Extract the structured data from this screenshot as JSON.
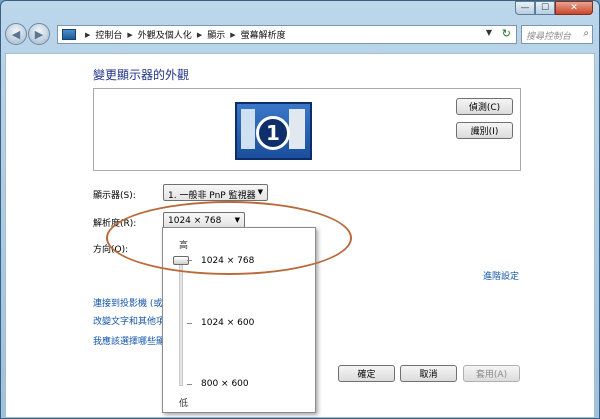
{
  "window": {
    "caption_buttons": [
      "—",
      "☐",
      "✕"
    ]
  },
  "address_bar": {
    "crumbs": [
      "控制台",
      "外觀及個人化",
      "顯示",
      "螢幕解析度"
    ],
    "search_placeholder": "搜尋控制台"
  },
  "main": {
    "title": "變更顯示器的外觀",
    "detect_button": "偵測(C)",
    "identify_button": "識別(I)",
    "monitor_number": "1",
    "display_label": "顯示器(S):",
    "display_value": "1. 一般非 PnP 監視器",
    "resolution_label": "解析度(R):",
    "resolution_value": "1024 × 768",
    "orientation_label": "方向(O):",
    "advanced_link": "進階設定",
    "links": [
      "連接到投影機 (或按",
      "改變文字和其他項",
      "我應該選擇哪些顯"
    ],
    "ok_button": "確定",
    "cancel_button": "取消",
    "apply_button": "套用(A)"
  },
  "resolution_popup": {
    "high_label": "高",
    "low_label": "低",
    "options": [
      "1024 × 768",
      "1024 × 600",
      "800 × 600"
    ],
    "selected_index": 0
  },
  "colors": {
    "title": "#1e3287",
    "link": "#1155aa",
    "annotation": "#b86a3a"
  }
}
